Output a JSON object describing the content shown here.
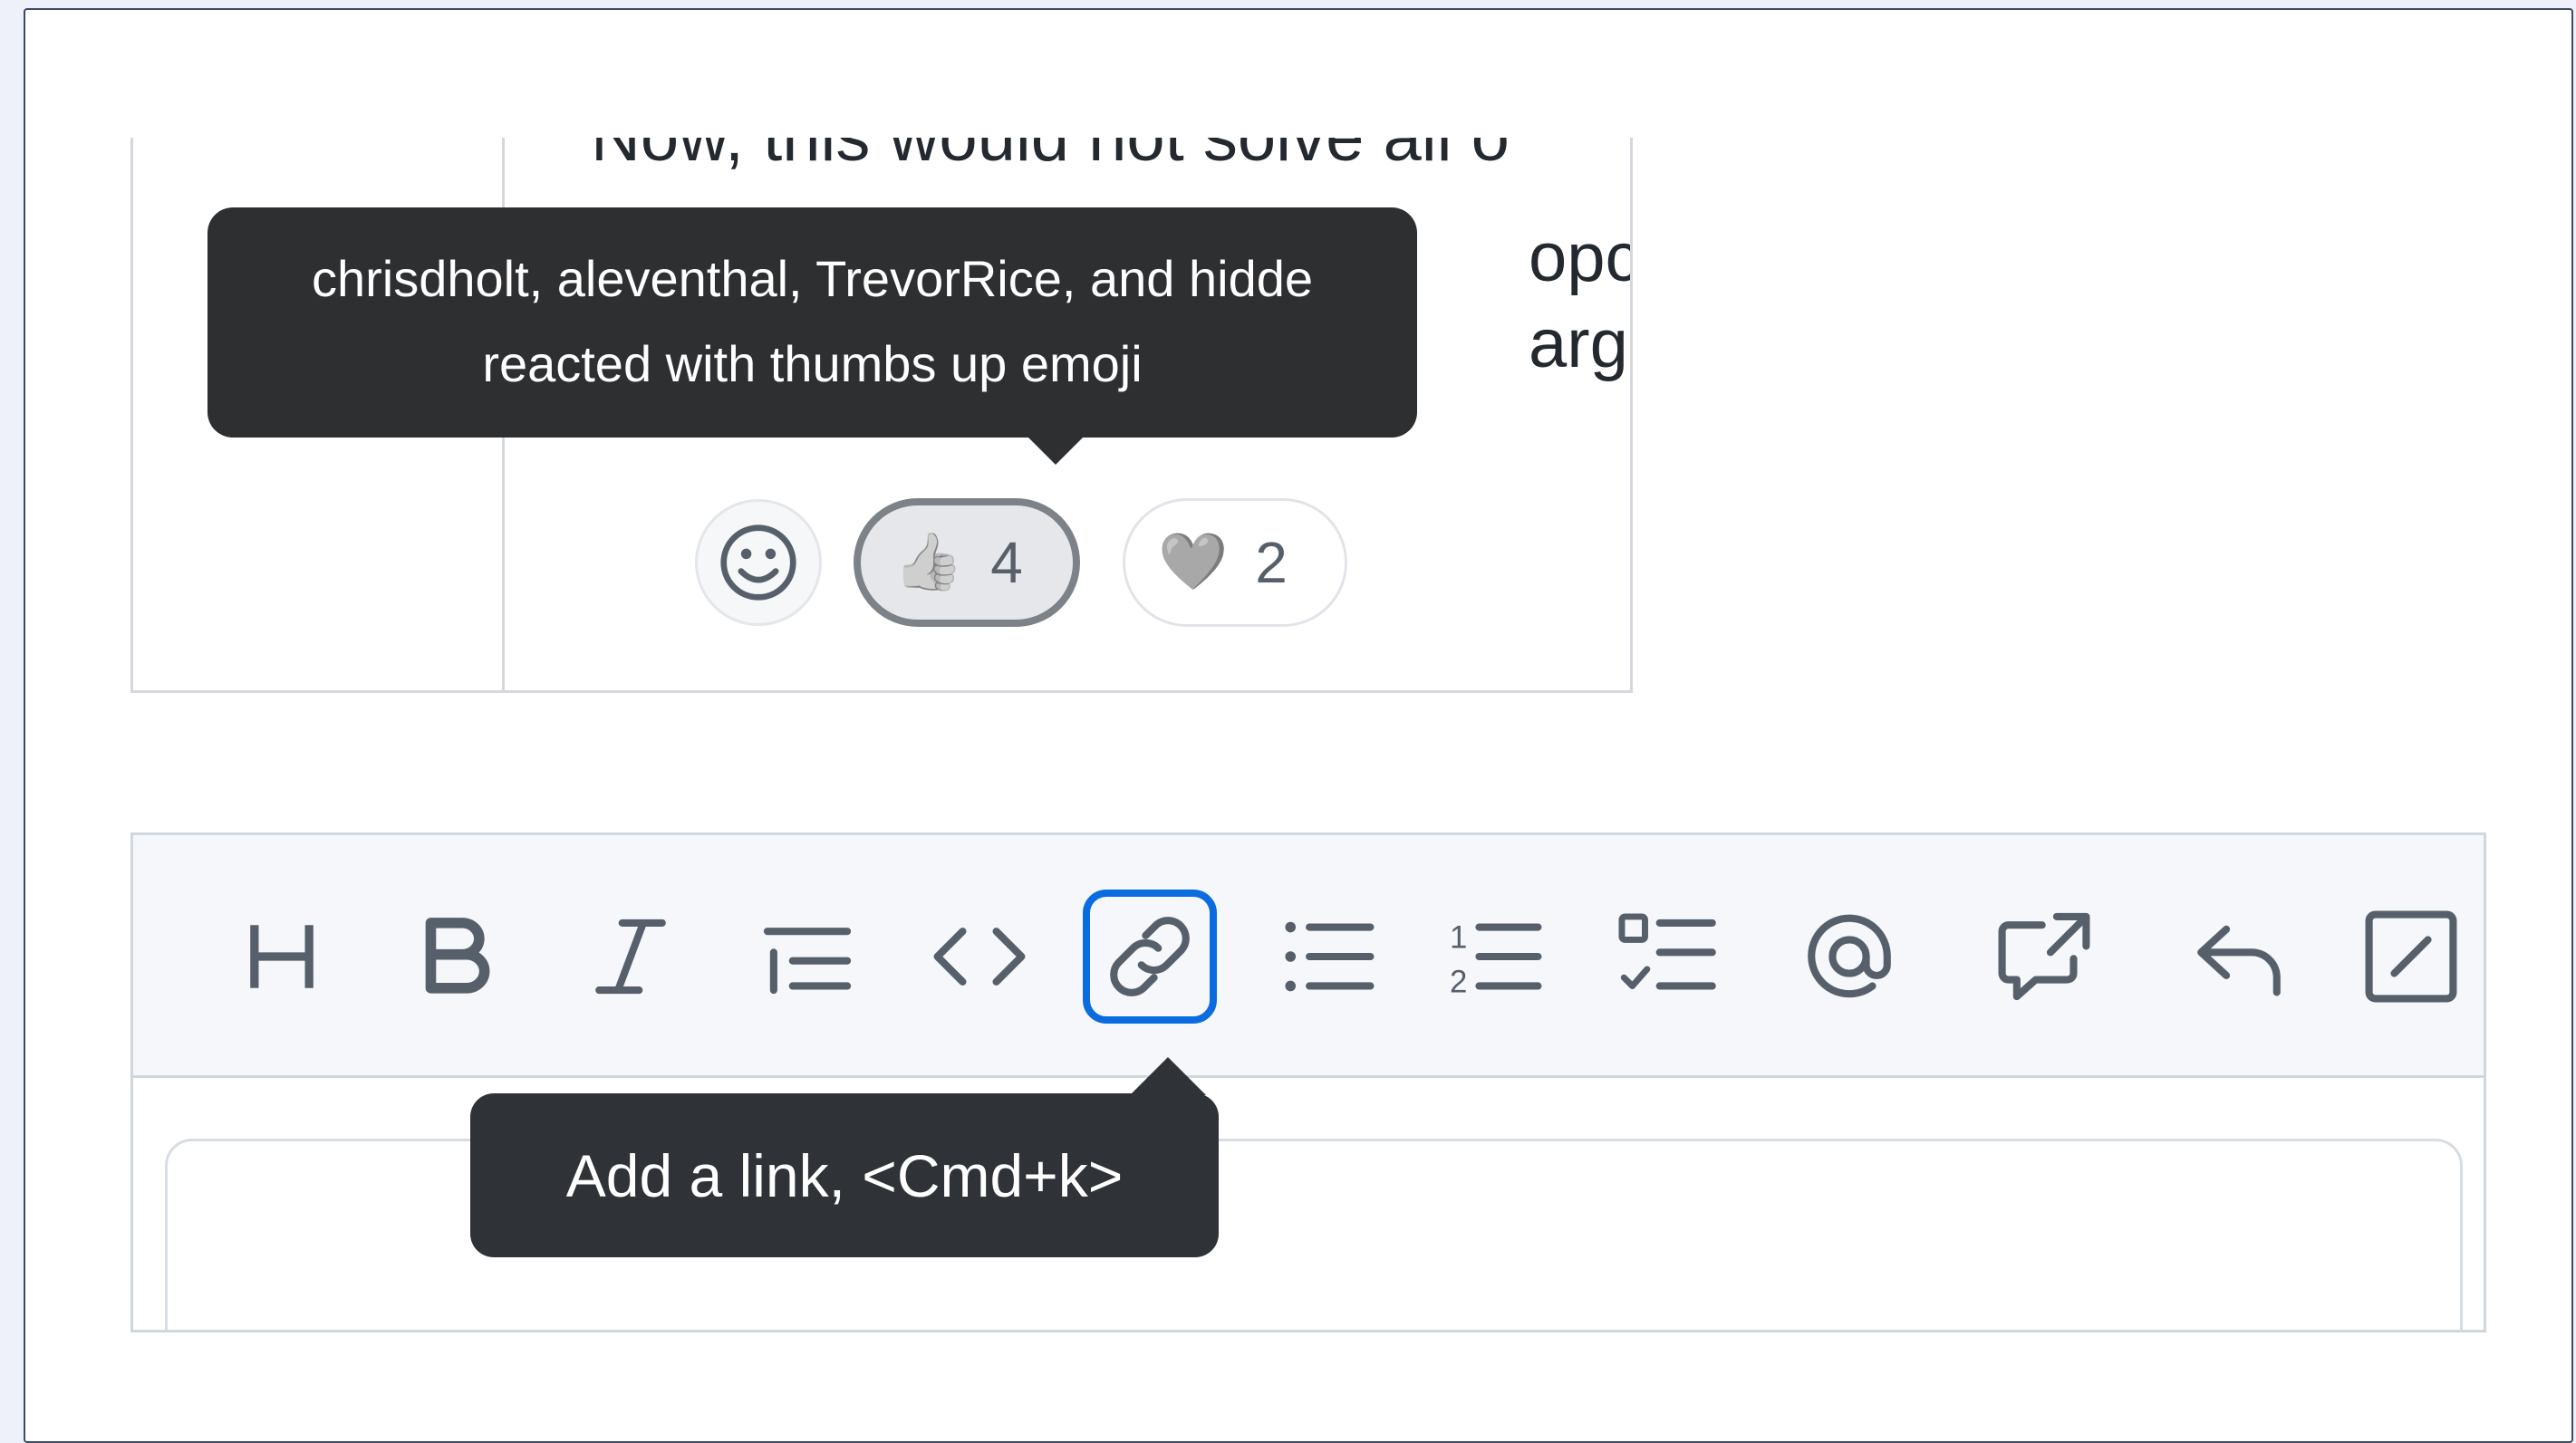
{
  "comment": {
    "lines": [
      "Now, this would not solve all o",
      "",
      ""
    ],
    "fragments": [
      "opc",
      "arge"
    ]
  },
  "reactions": {
    "add_reaction_label": "",
    "items": [
      {
        "icon": "thumbs-up-icon",
        "emoji": "👍",
        "count": "4",
        "selected": true
      },
      {
        "icon": "heart-icon",
        "emoji": "🩶",
        "count": "2",
        "selected": false
      }
    ]
  },
  "tooltips": {
    "reaction_tooltip_line1": "chrisdholt, aleventhal, TrevorRice, and hidde",
    "reaction_tooltip_line2": "reacted with thumbs up emoji",
    "link_tooltip": "Add a link, <Cmd+k>"
  },
  "toolbar": {
    "icon_color": "#57606a",
    "focus_color": "#0a6cdf",
    "buttons": [
      "heading-icon",
      "bold-icon",
      "italic-icon",
      "quote-icon",
      "code-icon",
      "link-icon",
      "bulleted-list-icon",
      "numbered-list-icon",
      "task-list-icon",
      "mention-icon",
      "cross-reference-icon",
      "reply-icon",
      "slash-command-icon"
    ]
  }
}
